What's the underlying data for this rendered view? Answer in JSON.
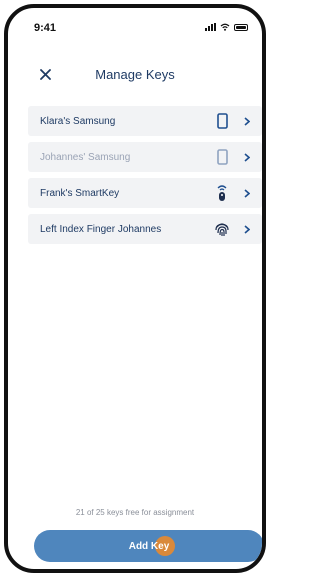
{
  "status_bar": {
    "time": "9:41"
  },
  "header": {
    "title": "Manage Keys",
    "close_icon": "close-icon"
  },
  "keys": [
    {
      "label": "Klara's Samsung",
      "icon": "smartphone-icon",
      "enabled": true
    },
    {
      "label": "Johannes' Samsung",
      "icon": "smartphone-icon",
      "enabled": false
    },
    {
      "label": "Frank's SmartKey",
      "icon": "smartkey-icon",
      "enabled": true
    },
    {
      "label": "Left Index Finger Johannes",
      "icon": "fingerprint-icon",
      "enabled": true
    }
  ],
  "footer": {
    "free_keys_text": "21 of 25 keys free for assignment",
    "add_button_label": "Add Key"
  },
  "colors": {
    "primary_text": "#1f3b64",
    "disabled_text": "#9aa3b5",
    "button_bg": "#4f86bd",
    "row_bg": "#f2f3f5",
    "touch_indicator": "#e88a2c"
  }
}
